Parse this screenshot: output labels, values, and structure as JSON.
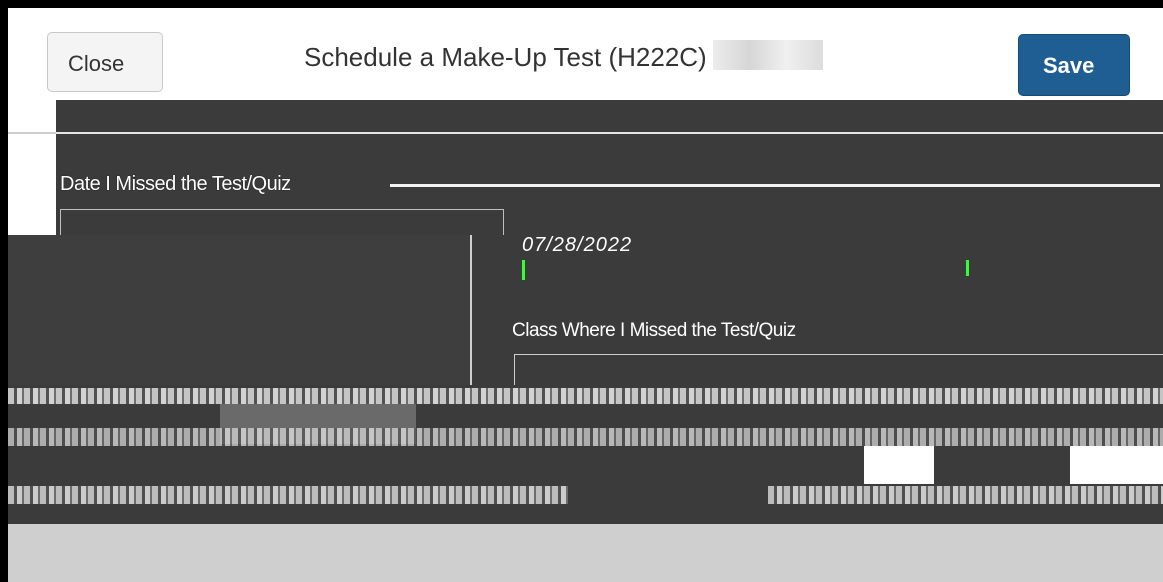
{
  "dialog": {
    "close_label": "Close",
    "title": "Schedule a Make-Up Test (H222C)",
    "save_label": "Save"
  },
  "form": {
    "date_missed_label": "Date I Missed the Test/Quiz",
    "date_value": "07/28/2022",
    "class_missed_label": "Class Where I Missed the Test/Quiz"
  },
  "colors": {
    "primary_button": "#1f5e92",
    "background_dark": "#3b3b3b",
    "highlight_green": "#33ff33"
  }
}
